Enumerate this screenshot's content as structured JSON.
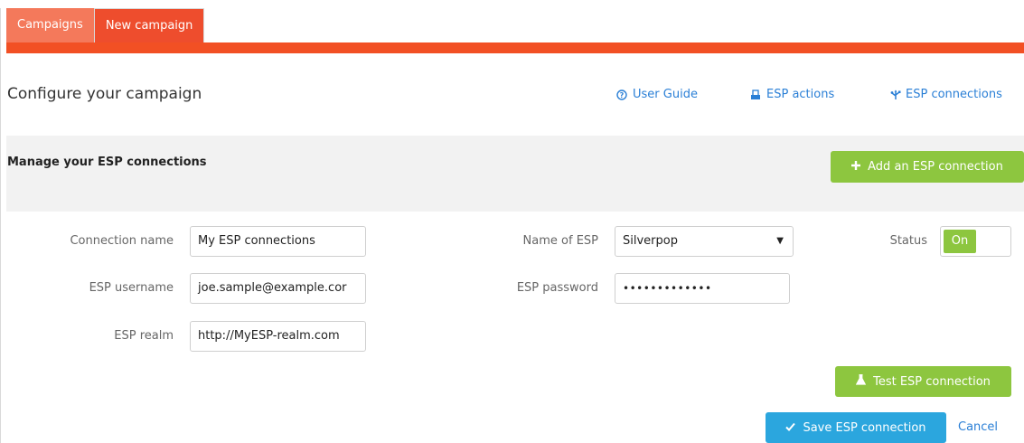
{
  "tabs": [
    {
      "label": "Campaigns"
    },
    {
      "label": "New campaign"
    }
  ],
  "header": {
    "title": "Configure your campaign",
    "links": {
      "user_guide": "User Guide",
      "esp_actions": "ESP actions",
      "esp_connections": "ESP connections"
    }
  },
  "section": {
    "title": "Manage your ESP connections",
    "add_button": "Add an ESP connection"
  },
  "form": {
    "connection_name": {
      "label": "Connection name",
      "value": "My ESP connections"
    },
    "esp_username": {
      "label": "ESP username",
      "value": "joe.sample@example.cor"
    },
    "esp_realm": {
      "label": "ESP realm",
      "value": "http://MyESP-realm.com"
    },
    "name_of_esp": {
      "label": "Name of ESP",
      "value": "Silverpop"
    },
    "esp_password": {
      "label": "ESP password",
      "value": "•••••••••••••"
    },
    "status": {
      "label": "Status",
      "value": "On"
    }
  },
  "actions": {
    "test": "Test ESP connection",
    "save": "Save ESP connection",
    "cancel": "Cancel"
  },
  "colors": {
    "tab_active": "#ee4d2d",
    "tab_inactive": "#f4795b",
    "brand_bar": "#f25024",
    "green": "#8dc63f",
    "blue": "#2ba6de",
    "link": "#2a7fd6"
  }
}
